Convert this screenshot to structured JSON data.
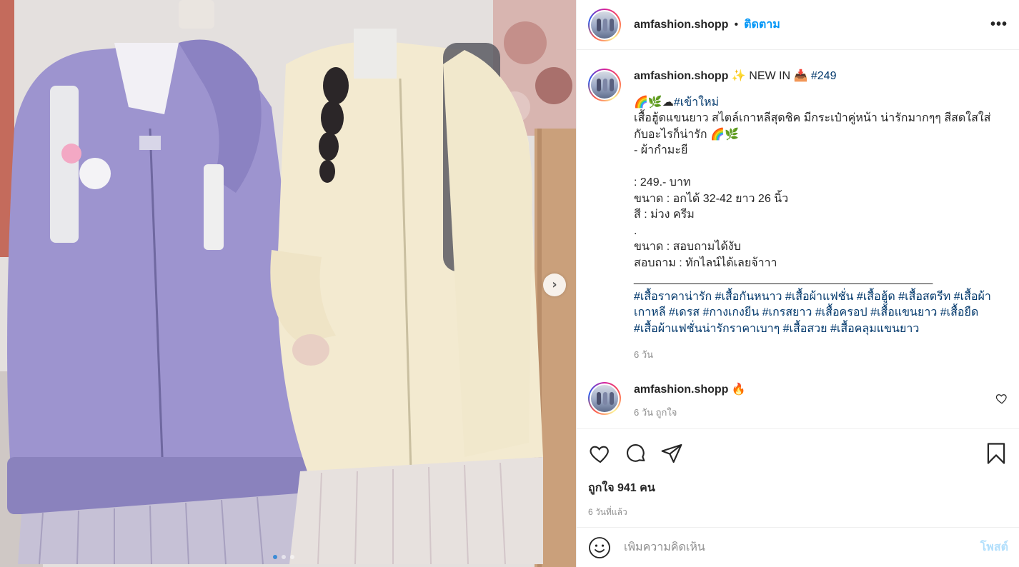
{
  "post": {
    "carousel": {
      "current_slide": 1,
      "total_slides": 3
    }
  },
  "header": {
    "username": "amfashion.shopp",
    "separator": "•",
    "follow_label": "ติดตาม",
    "more_label": "•••"
  },
  "caption": {
    "username": "amfashion.shopp",
    "title_emoji_1": "✨",
    "title_text": " NEW IN ",
    "title_emoji_2": "📥",
    "title_tag": "#249",
    "line1_emojis": "🌈🌿☁",
    "line1_tag": "#เข้าใหม่",
    "body": "เสื้อฮู้ดแขนยาว สไตล์เกาหลีสุดชิค มีกระเป๋าคู่หน้า น่ารักมากๆๆ สีสดใสใส่กับอะไรก็น่ารัก 🌈🌿\n- ผ้ากำมะยี\n\n: 249.- บาท\nขนาด : อกได้ 32-42 ยาว 26 นิ้ว\nสี : ม่วง ครีม\n.\nขนาด : สอบถามได้งับ\nสอบถาม : ทักไลน์ได้เลยจ้าาา\n_______________________________________________",
    "hashtags": "#เสื้อราคาน่ารัก #เสื้อกันหนาว #เสื้อผ้าแฟชั่น #เสื้อฮู้ด #เสื้อสตรีท #เสื้อผ้าเกาหลี #เดรส #กางเกงยีน #เกรสยาว #เสื้อครอป #เสื้อแขนยาว #เสื้อยืด #เสื้อผ้าแฟชั่นน่ารักราคาเบาๆ #เสื้อสวย #เสื้อคลุมแขนยาว",
    "time": "6 วัน"
  },
  "comment": {
    "username": "amfashion.shopp",
    "text": "🔥",
    "sub": "6 วัน ถูกใจ"
  },
  "actions": {
    "likes": "ถูกใจ 941 คน",
    "ago": "6 วันที่แล้ว"
  },
  "comment_box": {
    "placeholder": "เพิ่มความคิดเห็น",
    "post_label": "โพสต์"
  },
  "icons": {
    "next": "chevron-right-icon",
    "like": "heart-icon",
    "comment": "comment-bubble-icon",
    "share": "paper-plane-icon",
    "save": "bookmark-icon",
    "emoji": "smiley-icon"
  },
  "colors": {
    "follow": "#0095f6",
    "hashtag": "#00376b",
    "muted": "#8e8e8e",
    "post_disabled": "#b2dffc"
  }
}
